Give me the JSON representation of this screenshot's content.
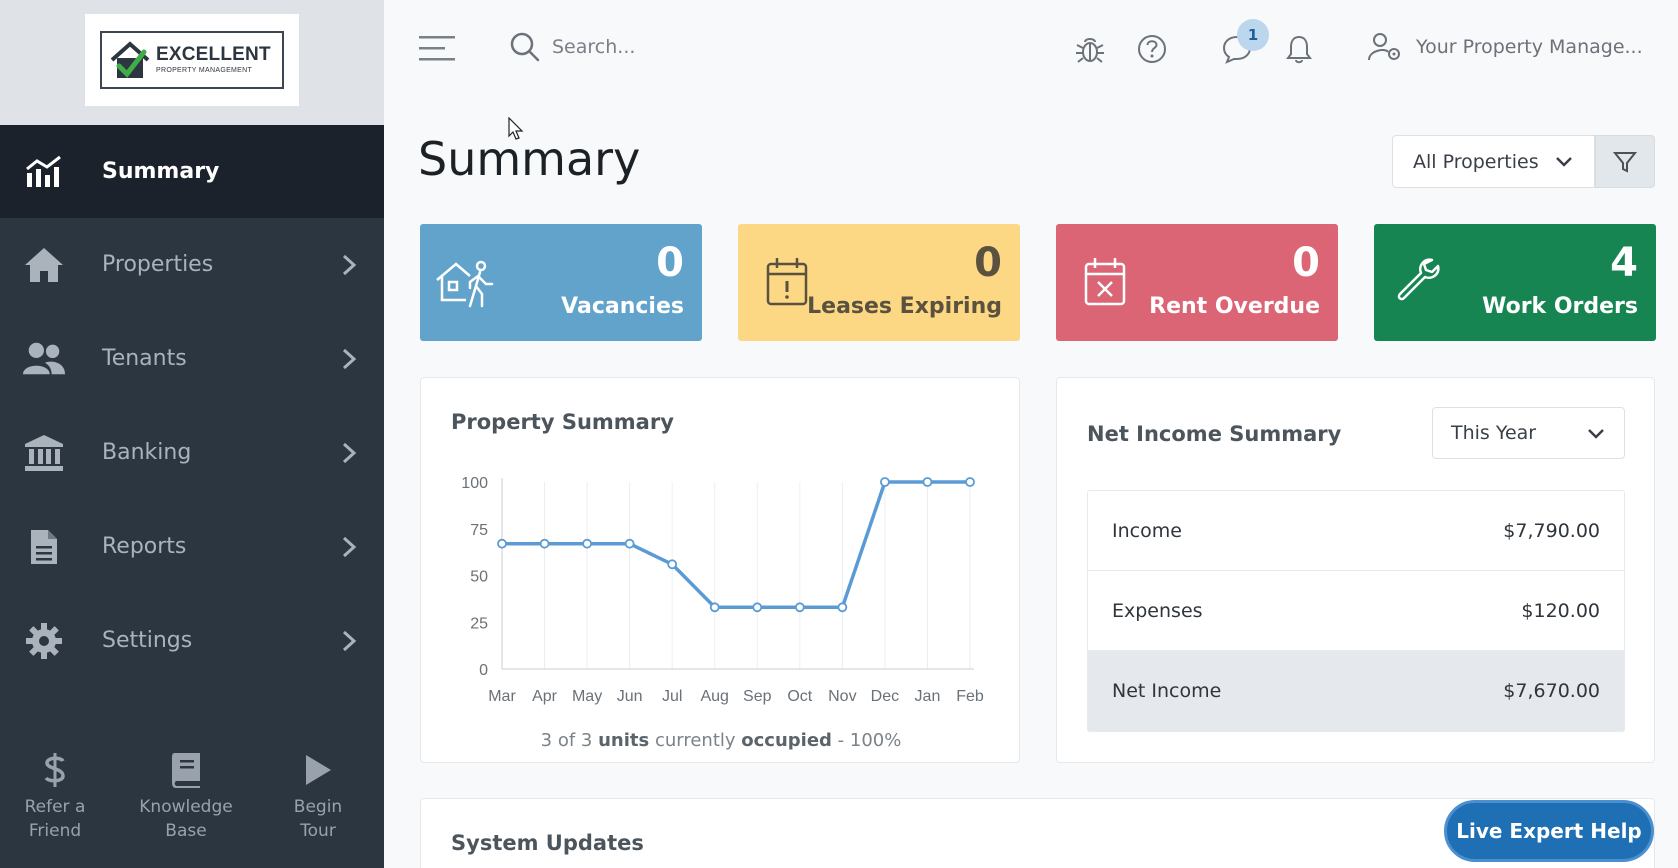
{
  "logo": {
    "title": "EXCELLENT",
    "subtitle": "PROPERTY MANAGEMENT"
  },
  "sidebar": {
    "items": [
      {
        "label": "Summary",
        "icon": "chart-icon"
      },
      {
        "label": "Properties",
        "icon": "home-icon"
      },
      {
        "label": "Tenants",
        "icon": "users-icon"
      },
      {
        "label": "Banking",
        "icon": "bank-icon"
      },
      {
        "label": "Reports",
        "icon": "document-icon"
      },
      {
        "label": "Settings",
        "icon": "gear-icon"
      }
    ],
    "bottom": [
      {
        "line1": "Refer a",
        "line2": "Friend",
        "icon": "dollar-icon"
      },
      {
        "line1": "Knowledge",
        "line2": "Base",
        "icon": "book-icon"
      },
      {
        "line1": "Begin",
        "line2": "Tour",
        "icon": "play-icon"
      }
    ]
  },
  "header": {
    "search_placeholder": "Search...",
    "messages_count": "1",
    "user_name": "Your Property Manage..."
  },
  "page": {
    "title": "Summary",
    "property_filter": "All Properties"
  },
  "cards": [
    {
      "value": "0",
      "label": "Vacancies",
      "color": "#62a3cb"
    },
    {
      "value": "0",
      "label": "Leases Expiring",
      "color": "#fcd885"
    },
    {
      "value": "0",
      "label": "Rent Overdue",
      "color": "#db6575"
    },
    {
      "value": "4",
      "label": "Work Orders",
      "color": "#168552"
    }
  ],
  "property_summary": {
    "title": "Property Summary",
    "occ_prefix": "3 of 3",
    "occ_units": "units",
    "occ_middle": "currently",
    "occ_occupied": "occupied",
    "occ_suffix": "- 100%"
  },
  "chart_data": {
    "type": "line",
    "categories": [
      "Mar",
      "Apr",
      "May",
      "Jun",
      "Jul",
      "Aug",
      "Sep",
      "Oct",
      "Nov",
      "Dec",
      "Jan",
      "Feb"
    ],
    "values": [
      67,
      67,
      67,
      67,
      56,
      33,
      33,
      33,
      33,
      100,
      100,
      100
    ],
    "yticks": [
      0,
      25,
      50,
      75,
      100
    ],
    "ylim": [
      0,
      100
    ],
    "grid": true,
    "color": "#5b9bd5"
  },
  "net_income": {
    "title": "Net Income Summary",
    "period": "This Year",
    "rows": [
      {
        "label": "Income",
        "value": "$7,790.00"
      },
      {
        "label": "Expenses",
        "value": "$120.00"
      },
      {
        "label": "Net Income",
        "value": "$7,670.00"
      }
    ]
  },
  "system_updates": {
    "title": "System Updates"
  },
  "live_help": "Live Expert Help"
}
